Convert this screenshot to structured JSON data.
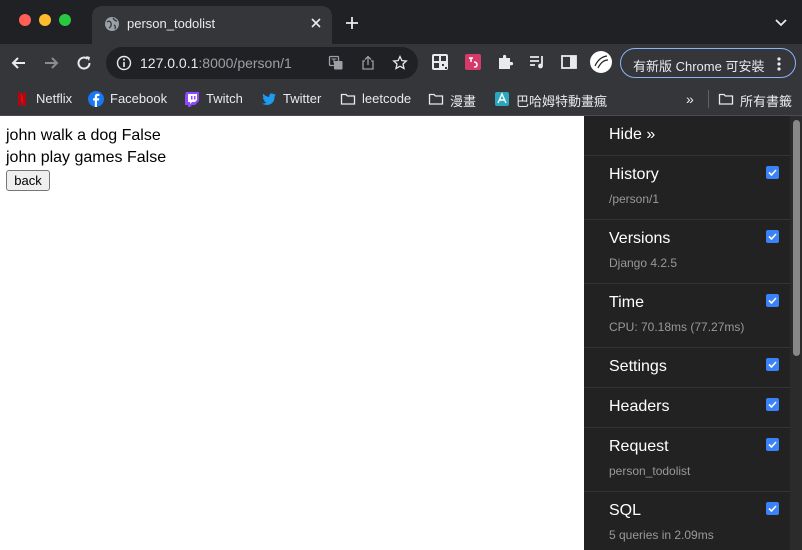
{
  "browser": {
    "tab": {
      "title": "person_todolist",
      "icon": "globe-icon"
    },
    "address": {
      "host": "127.0.0.1",
      "path": ":8000/person/1"
    },
    "update_label": "有新版 Chrome 可安裝",
    "bookmarks": [
      {
        "label": "Netflix",
        "icon": "netflix-icon"
      },
      {
        "label": "Facebook",
        "icon": "facebook-icon"
      },
      {
        "label": "Twitch",
        "icon": "twitch-icon"
      },
      {
        "label": "Twitter",
        "icon": "twitter-icon"
      },
      {
        "label": "leetcode",
        "icon": "folder-icon"
      },
      {
        "label": "漫畫",
        "icon": "folder-icon"
      },
      {
        "label": "巴哈姆特動畫瘋",
        "icon": "bahamut-icon"
      }
    ],
    "bookmarks_more": "»",
    "all_bookmarks": "所有書籤"
  },
  "page": {
    "todos": [
      "john walk a dog False",
      "john play games False"
    ],
    "back_label": "back"
  },
  "debug_toolbar": {
    "hide_label": "Hide »",
    "panels": [
      {
        "title": "History",
        "subtitle": "/person/1",
        "checked": true
      },
      {
        "title": "Versions",
        "subtitle": "Django 4.2.5",
        "checked": true
      },
      {
        "title": "Time",
        "subtitle": "CPU: 70.18ms (77.27ms)",
        "checked": true
      },
      {
        "title": "Settings",
        "subtitle": "",
        "checked": true
      },
      {
        "title": "Headers",
        "subtitle": "",
        "checked": true
      },
      {
        "title": "Request",
        "subtitle": "person_todolist",
        "checked": true
      },
      {
        "title": "SQL",
        "subtitle": "5 queries in 2.09ms",
        "checked": true
      }
    ]
  },
  "colors": {
    "chrome_dark": "#202124",
    "chrome_toolbar": "#35363a",
    "djdt_bg": "#222222",
    "checkbox": "#3b82f6"
  }
}
